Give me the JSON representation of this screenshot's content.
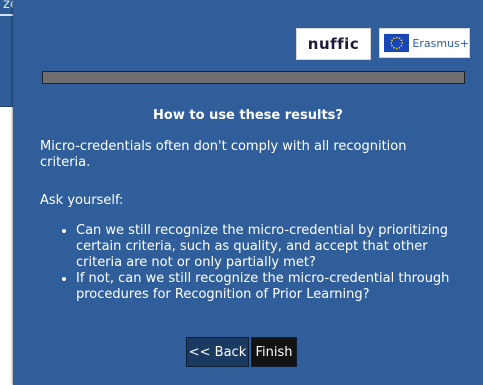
{
  "background_window": {
    "title_fragment": "ze a"
  },
  "dialog": {
    "logos": {
      "nuffic": "nuffic",
      "erasmus": "Erasmus+"
    },
    "progress_fraction": 1.0,
    "heading": "How to use these results?",
    "paragraph1": "Micro-credentials often don't comply with all recognition criteria.",
    "paragraph2": "Ask yourself:",
    "bullets": [
      "Can we still recognize the micro-credential by prioritizing certain criteria, such as quality, and accept that other criteria are not or only partially met?",
      "If not, can we still recognize the micro-credential through procedures for Recognition of Prior Learning?"
    ],
    "buttons": {
      "back": "<< Back",
      "finish": "Finish"
    }
  },
  "colors": {
    "panel": "#2f5e9a",
    "back_button": "#1b3a61",
    "finish_button": "#121212",
    "progress": "#6f6f6f"
  }
}
